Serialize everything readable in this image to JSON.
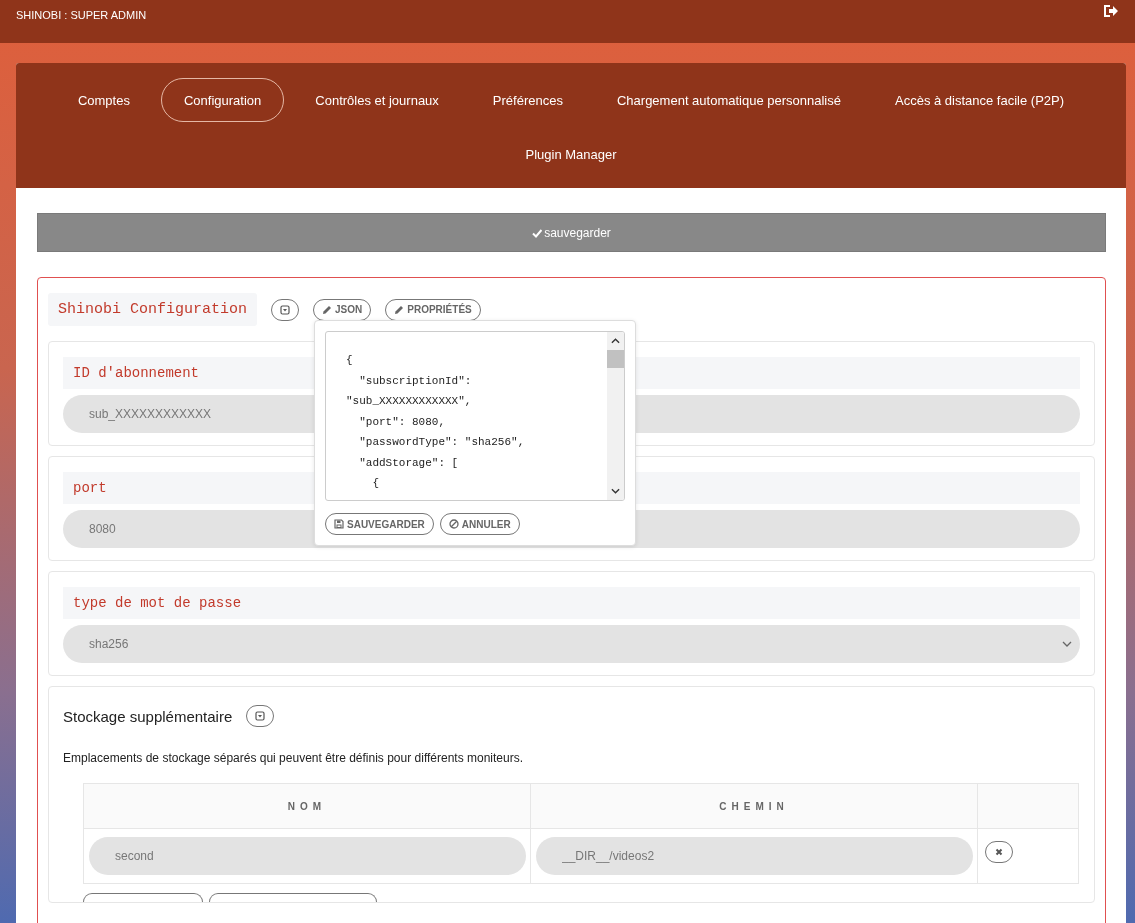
{
  "header": {
    "title": "SHINOBI : SUPER ADMIN"
  },
  "tabs": [
    {
      "label": "Comptes",
      "selected": false
    },
    {
      "label": "Configuration",
      "selected": true
    },
    {
      "label": "Contrôles et journaux",
      "selected": false
    },
    {
      "label": "Préférences",
      "selected": false
    },
    {
      "label": "Chargement automatique personnalisé",
      "selected": false
    },
    {
      "label": "Accès à distance facile (P2P)",
      "selected": false
    },
    {
      "label": "Plugin Manager",
      "selected": false
    }
  ],
  "save_button": {
    "label": "sauvegarder"
  },
  "config": {
    "title": "Shinobi Configuration",
    "mode_buttons": [
      "JSON",
      "PROPRIÉTÉS"
    ],
    "fields": [
      {
        "label": "ID d'abonnement",
        "kind": "input",
        "value": "sub_XXXXXXXXXXXX"
      },
      {
        "label": "port",
        "kind": "input",
        "value": "8080"
      },
      {
        "label": "type de mot de passe",
        "kind": "select",
        "value": "sha256"
      }
    ],
    "storage": {
      "title": "Stockage supplémentaire",
      "description": "Emplacements de stockage séparés qui peuvent être définis pour différents moniteurs.",
      "columns": [
        "NOM",
        "CHEMIN"
      ],
      "rows": [
        {
          "name": "second",
          "path": "__DIR__/videos2"
        }
      ]
    }
  },
  "json_popup": {
    "lines": [
      "{",
      "  \"subscriptionId\":",
      "\"sub_XXXXXXXXXXXX\",",
      "  \"port\": 8080,",
      "  \"passwordType\": \"sha256\",",
      "  \"addStorage\": [",
      "    {"
    ],
    "buttons": [
      {
        "label": "SAUVEGARDER",
        "kind": "save"
      },
      {
        "label": "ANNULER",
        "kind": "cancel"
      }
    ]
  }
}
